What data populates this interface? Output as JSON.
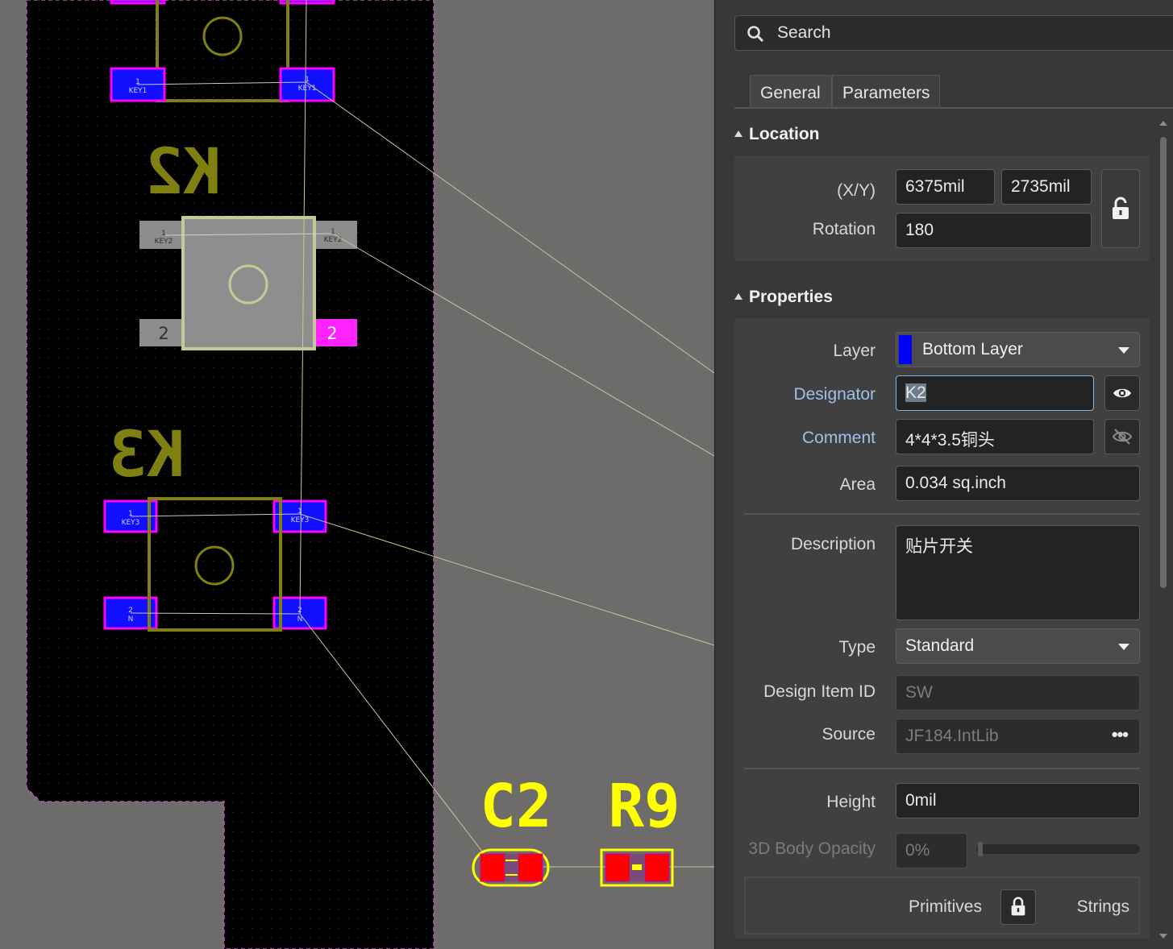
{
  "pcb": {
    "designators": [
      "K2",
      "K3",
      "C2",
      "R9"
    ],
    "pad_labels": {
      "key1_pin": "1",
      "key1_net": "KEY1",
      "key2_pin": "1",
      "key2_net": "KEY2",
      "key2_pin2": "2",
      "key3_pin": "1",
      "key3_net": "KEY3",
      "n_pin": "2",
      "n_net": "N"
    },
    "colors": {
      "board": "#000000",
      "overlay": "#7f7f12",
      "pad_top": "#1010ff",
      "pad_outline": "#ff00ff",
      "selected": "#d0d0a0",
      "ratsnest": "#c8c89a",
      "smd_red": "#ff0000",
      "silk_yellow": "#ffff00"
    }
  },
  "panel": {
    "search_placeholder": "Search",
    "tabs": [
      "General",
      "Parameters"
    ],
    "location": {
      "title": "Location",
      "xy_label": "(X/Y)",
      "x": "6375mil",
      "y": "2735mil",
      "rotation_label": "Rotation",
      "rotation": "180",
      "lock_icon": "unlock-icon"
    },
    "properties": {
      "title": "Properties",
      "layer_label": "Layer",
      "layer": "Bottom Layer",
      "layer_color": "#0000ff",
      "designator_label": "Designator",
      "designator": "K2",
      "comment_label": "Comment",
      "comment": "4*4*3.5铜头",
      "area_label": "Area",
      "area": "0.034 sq.inch",
      "description_label": "Description",
      "description": "贴片开关",
      "type_label": "Type",
      "type": "Standard",
      "design_item_id_label": "Design Item ID",
      "design_item_id": "SW",
      "source_label": "Source",
      "source": "JF184.IntLib",
      "source_more": "•••",
      "height_label": "Height",
      "height": "0mil",
      "opacity_label": "3D Body Opacity",
      "opacity": "0%",
      "primitives_label": "Primitives",
      "strings_label": "Strings"
    }
  }
}
